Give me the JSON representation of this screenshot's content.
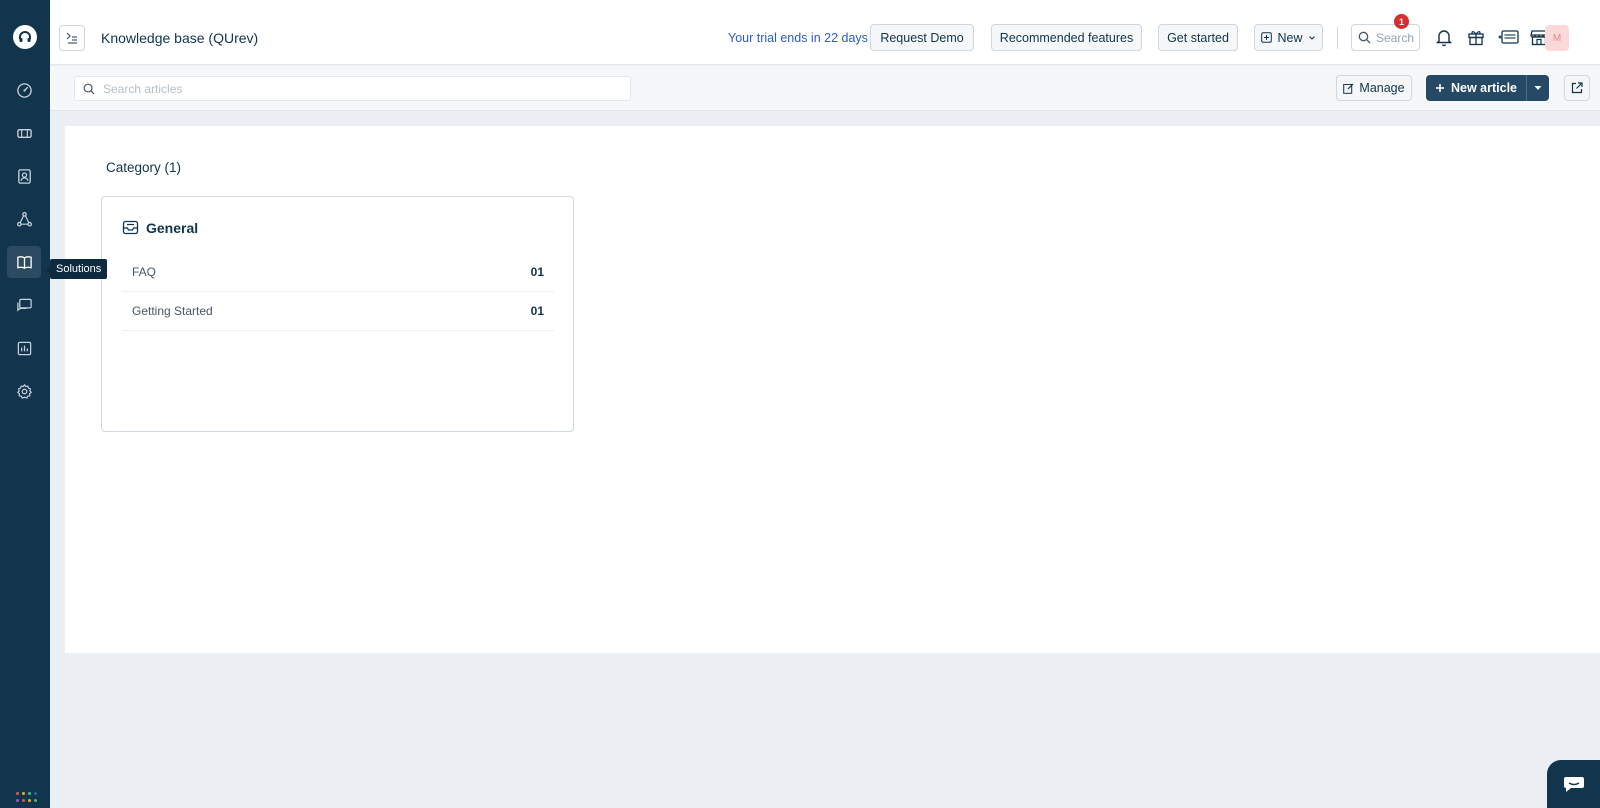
{
  "header": {
    "title": "Knowledge base (QUrev)",
    "trial_text": "Your trial ends in 22 days",
    "request_demo": "Request Demo",
    "recommended_features": "Recommended features",
    "get_started": "Get started",
    "new_label": "New",
    "search_label": "Search",
    "gift_badge_count": "1",
    "avatar_initial": "M"
  },
  "sidebar": {
    "tooltip": "Solutions",
    "items": [
      {
        "icon": "dashboard-icon"
      },
      {
        "icon": "tickets-icon"
      },
      {
        "icon": "contacts-icon"
      },
      {
        "icon": "workflow-icon"
      },
      {
        "icon": "solutions-book-icon",
        "active": true
      },
      {
        "icon": "conversations-icon"
      },
      {
        "icon": "reports-icon"
      },
      {
        "icon": "settings-gear-icon"
      }
    ],
    "apps_dot_colors": [
      "#e5534b",
      "#f5a623",
      "#3ac27a",
      "#2c5cc5",
      "#9b59b6",
      "#e5534b",
      "#f5a623",
      "#3ac27a"
    ]
  },
  "toolbar": {
    "search_placeholder": "Search articles",
    "manage_label": "Manage",
    "new_article_label": "New article"
  },
  "content": {
    "category_heading": "Category (1)",
    "categories": [
      {
        "name": "General",
        "folders": [
          {
            "name": "FAQ",
            "count": "01"
          },
          {
            "name": "Getting Started",
            "count": "01"
          }
        ]
      }
    ]
  },
  "colors": {
    "sidebar_bg": "#12344d",
    "primary_button": "#264966",
    "link_blue": "#2c5cc5",
    "badge_red": "#d72d30"
  }
}
